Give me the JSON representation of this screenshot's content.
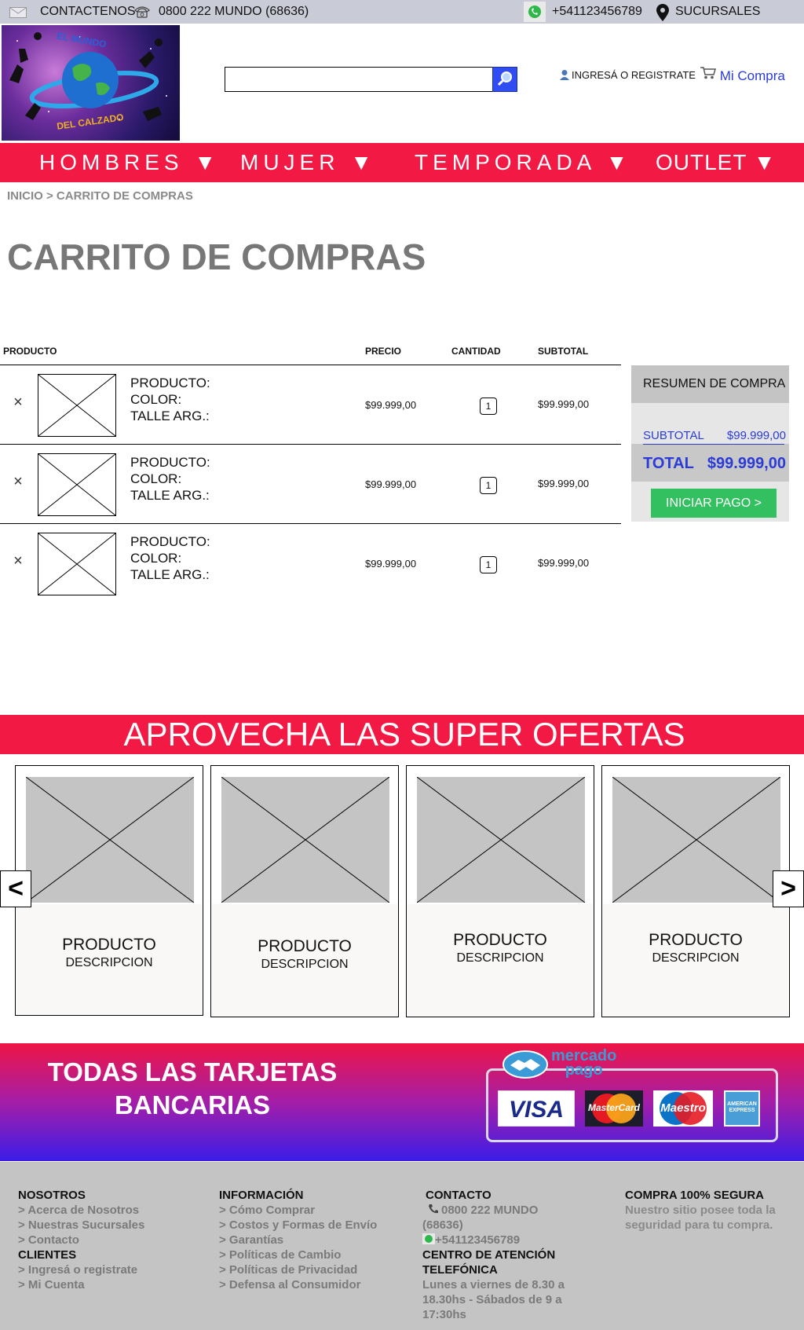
{
  "topbar": {
    "contact_label": "CONTACTENOS",
    "phone": "0800 222 MUNDO (68636)",
    "whatsapp": "+541123456789",
    "branches": "SUCURSALES",
    "icons": [
      "mail-icon",
      "telephone-icon",
      "whatsapp-icon",
      "location-pin-icon"
    ]
  },
  "header": {
    "logo_text_top": "EL MUNDO",
    "logo_text_bottom": "DEL CALZADO",
    "search_placeholder": "",
    "login_label": "INGRESÁ O REGISTRATE",
    "cart_label": "Mi Compra"
  },
  "nav": {
    "items": [
      {
        "label": "HOMBRES ▼"
      },
      {
        "label": "MUJER ▼"
      },
      {
        "label": "TEMPORADA ▼"
      },
      {
        "label": "OUTLET ▼"
      }
    ]
  },
  "breadcrumb": "INICIO > CARRITO DE COMPRAS",
  "page_title": "CARRITO DE COMPRAS",
  "cart": {
    "headers": {
      "product": "PRODUCTO",
      "price": "PRECIO",
      "quantity": "CANTIDAD",
      "subtotal": "SUBTOTAL"
    },
    "remove_symbol": "×",
    "rows": [
      {
        "product": "PRODUCTO:",
        "color": "COLOR:",
        "size": "TALLE ARG.:",
        "price": "$99.999,00",
        "qty": "1",
        "subtotal": "$99.999,00"
      },
      {
        "product": "PRODUCTO:",
        "color": "COLOR:",
        "size": "TALLE ARG.:",
        "price": "$99.999,00",
        "qty": "1",
        "subtotal": "$99.999,00"
      },
      {
        "product": "PRODUCTO:",
        "color": "COLOR:",
        "size": "TALLE ARG.:",
        "price": "$99.999,00",
        "qty": "1",
        "subtotal": "$99.999,00"
      }
    ]
  },
  "summary": {
    "title": "RESUMEN DE COMPRA",
    "subtotal_label": "SUBTOTAL",
    "subtotal_value": "$99.999,00",
    "total_label": "TOTAL",
    "total_value": "$99.999,00",
    "checkout_label": "INICIAR PAGO >"
  },
  "offers": {
    "title": "APROVECHA LAS SUPER OFERTAS",
    "prev": "<",
    "next": ">",
    "cards": [
      {
        "name": "PRODUCTO",
        "desc": "DESCRIPCION"
      },
      {
        "name": "PRODUCTO",
        "desc": "DESCRIPCION"
      },
      {
        "name": "PRODUCTO",
        "desc": "DESCRIPCION"
      },
      {
        "name": "PRODUCTO",
        "desc": "DESCRIPCION"
      }
    ]
  },
  "payment": {
    "title_line1": "TODAS LAS TARJETAS",
    "title_line2": "BANCARIAS",
    "mp_line1": "mercado",
    "mp_line2": "pago",
    "cards": [
      "VISA",
      "MasterCard",
      "Maestro",
      "AMERICAN EXPRESS"
    ]
  },
  "footer": {
    "nosotros": {
      "title": "NOSOTROS",
      "links": [
        "> Acerca de Nosotros",
        "> Nuestras Sucursales",
        "> Contacto"
      ]
    },
    "clientes": {
      "title": "CLIENTES",
      "links": [
        "> Ingresá o registrate",
        "> Mi Cuenta"
      ]
    },
    "informacion": {
      "title": "INFORMACIÓN",
      "links": [
        "> Cómo Comprar",
        "> Costos y Formas de Envío",
        "> Garantías",
        "> Políticas de Cambio",
        "> Políticas de Privacidad",
        "> Defensa al Consumidor"
      ]
    },
    "contacto": {
      "title": "CONTACTO",
      "phone": "0800 222 MUNDO",
      "phone_code": "(68636)",
      "whatsapp": "+541123456789",
      "center_title_1": "CENTRO DE ATENCIÓN",
      "center_title_2": "TELEFÓNICA",
      "hours_1": "Lunes a viernes de 8.30 a",
      "hours_2": "18.30hs - Sábados de 9 a",
      "hours_3": "17:30hs"
    },
    "segura": {
      "title": "COMPRA 100% SEGURA",
      "text_1": "Nuestro sitio posee toda la",
      "text_2": "seguridad para tu compra."
    }
  },
  "colors": {
    "accent_red": "#f21a45",
    "link_blue": "#2b3bd8",
    "checkout_green": "#33c060",
    "footer_gray": "#c4c4c4"
  }
}
